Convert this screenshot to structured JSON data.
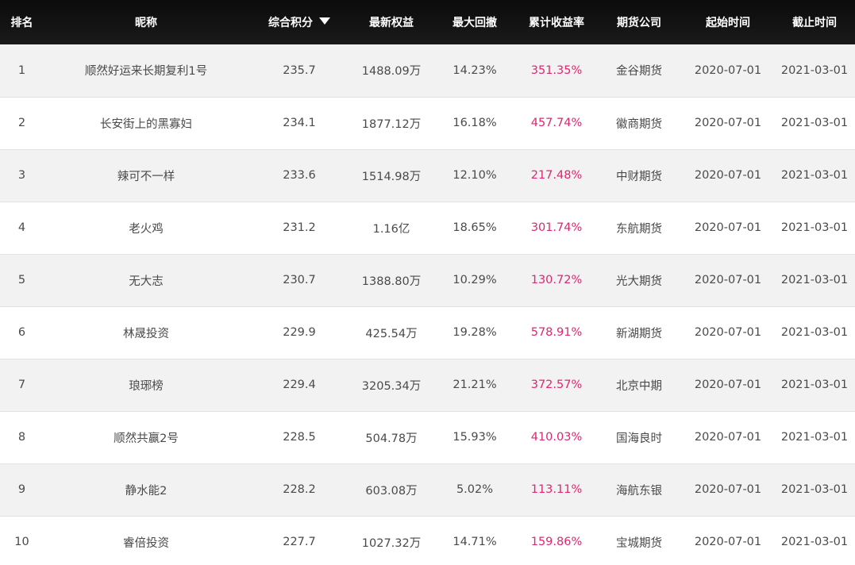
{
  "header": {
    "rank": "排名",
    "nickname": "昵称",
    "score": "综合积分",
    "equity": "最新权益",
    "drawdown": "最大回撤",
    "return": "累计收益率",
    "company": "期货公司",
    "start": "起始时间",
    "end": "截止时间",
    "sort_icon": "caret-down-icon"
  },
  "colors": {
    "header_bg": "#111111",
    "row_alt_bg": "#f2f2f2",
    "return_color": "#e0266f",
    "text": "#4a4a4a"
  },
  "rows": [
    {
      "rank": "1",
      "nickname": "顺然好运来长期复利1号",
      "score": "235.7",
      "equity": "1488.09万",
      "drawdown": "14.23%",
      "return": "351.35%",
      "company": "金谷期货",
      "start": "2020-07-01",
      "end": "2021-03-01"
    },
    {
      "rank": "2",
      "nickname": "长安街上的黑寡妇",
      "score": "234.1",
      "equity": "1877.12万",
      "drawdown": "16.18%",
      "return": "457.74%",
      "company": "徽商期货",
      "start": "2020-07-01",
      "end": "2021-03-01"
    },
    {
      "rank": "3",
      "nickname": "辣可不一样",
      "score": "233.6",
      "equity": "1514.98万",
      "drawdown": "12.10%",
      "return": "217.48%",
      "company": "中财期货",
      "start": "2020-07-01",
      "end": "2021-03-01"
    },
    {
      "rank": "4",
      "nickname": "老火鸡",
      "score": "231.2",
      "equity": "1.16亿",
      "drawdown": "18.65%",
      "return": "301.74%",
      "company": "东航期货",
      "start": "2020-07-01",
      "end": "2021-03-01"
    },
    {
      "rank": "5",
      "nickname": "无大志",
      "score": "230.7",
      "equity": "1388.80万",
      "drawdown": "10.29%",
      "return": "130.72%",
      "company": "光大期货",
      "start": "2020-07-01",
      "end": "2021-03-01"
    },
    {
      "rank": "6",
      "nickname": "林晟投资",
      "score": "229.9",
      "equity": "425.54万",
      "drawdown": "19.28%",
      "return": "578.91%",
      "company": "新湖期货",
      "start": "2020-07-01",
      "end": "2021-03-01"
    },
    {
      "rank": "7",
      "nickname": "琅琊榜",
      "score": "229.4",
      "equity": "3205.34万",
      "drawdown": "21.21%",
      "return": "372.57%",
      "company": "北京中期",
      "start": "2020-07-01",
      "end": "2021-03-01"
    },
    {
      "rank": "8",
      "nickname": "顺然共赢2号",
      "score": "228.5",
      "equity": "504.78万",
      "drawdown": "15.93%",
      "return": "410.03%",
      "company": "国海良时",
      "start": "2020-07-01",
      "end": "2021-03-01"
    },
    {
      "rank": "9",
      "nickname": "静水能2",
      "score": "228.2",
      "equity": "603.08万",
      "drawdown": "5.02%",
      "return": "113.11%",
      "company": "海航东银",
      "start": "2020-07-01",
      "end": "2021-03-01"
    },
    {
      "rank": "10",
      "nickname": "睿倍投资",
      "score": "227.7",
      "equity": "1027.32万",
      "drawdown": "14.71%",
      "return": "159.86%",
      "company": "宝城期货",
      "start": "2020-07-01",
      "end": "2021-03-01"
    }
  ]
}
